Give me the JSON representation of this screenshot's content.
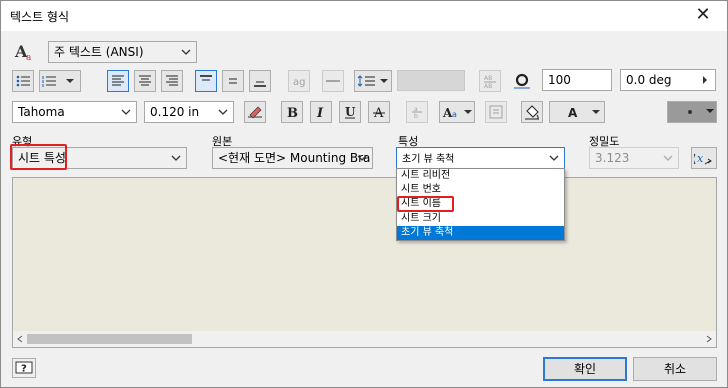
{
  "window": {
    "title": "텍스트 형식"
  },
  "row1": {
    "style_value": "주 텍스트 (ANSI)"
  },
  "row2": {
    "width_value": "100",
    "angle_value": "0.0 deg"
  },
  "row3": {
    "font_value": "Tahoma",
    "size_value": "0.120 in"
  },
  "fields": {
    "type": {
      "label": "유형",
      "value": "시트 특성"
    },
    "source": {
      "label": "원본",
      "value": "<현재 도면> Mounting Bra"
    },
    "property": {
      "label": "특성",
      "value": "초기 뷰 축척"
    },
    "precision": {
      "label": "정밀도",
      "value": "3.123"
    }
  },
  "property_options": [
    "시트 리비전",
    "시트 번호",
    "시트 이름",
    "시트 크기",
    "초기 뷰 축척"
  ],
  "buttons": {
    "ok": "확인",
    "cancel": "취소"
  },
  "colors": {
    "highlight_blue": "#0078d7",
    "callout_red": "#e02020",
    "text_area_bg": "#ebe8dc"
  }
}
